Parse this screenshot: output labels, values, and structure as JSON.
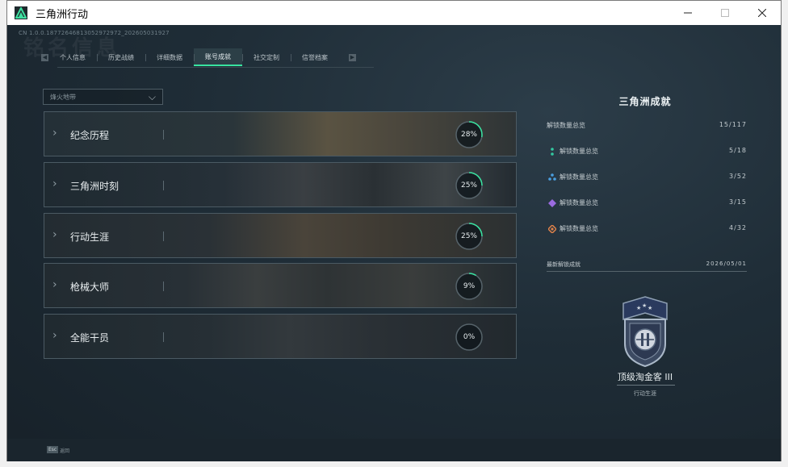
{
  "window": {
    "title": "三角洲行动"
  },
  "header": {
    "cn_id": "CN 1.0.0.18772646813052972972_202605031927",
    "bg_word": "铭名信息"
  },
  "tabs": [
    {
      "label": "个人信息"
    },
    {
      "label": "历史战绩"
    },
    {
      "label": "详细数据"
    },
    {
      "label": "账号成就"
    },
    {
      "label": "社交定制"
    },
    {
      "label": "信誉档案"
    }
  ],
  "dropdown": {
    "value": "烽火地带"
  },
  "categories": [
    {
      "name": "纪念历程",
      "percent": "28%",
      "progress": 0.28
    },
    {
      "name": "三角洲时刻",
      "percent": "25%",
      "progress": 0.25
    },
    {
      "name": "行动生涯",
      "percent": "25%",
      "progress": 0.25
    },
    {
      "name": "枪械大师",
      "percent": "9%",
      "progress": 0.09
    },
    {
      "name": "全能干员",
      "percent": "0%",
      "progress": 0.0
    }
  ],
  "summary": {
    "title": "三角洲成就",
    "total_label": "解锁数量总览",
    "total_value": "15/117",
    "rows": [
      {
        "label": "解锁数量总览",
        "value": "5/18",
        "icon": "green-tier-icon",
        "color": "#33c9a0"
      },
      {
        "label": "解锁数量总览",
        "value": "3/52",
        "icon": "blue-tier-icon",
        "color": "#4a9fe0"
      },
      {
        "label": "解锁数量总览",
        "value": "3/15",
        "icon": "purple-tier-icon",
        "color": "#9a6be0"
      },
      {
        "label": "解锁数量总览",
        "value": "4/32",
        "icon": "orange-tier-icon",
        "color": "#e0824a"
      }
    ]
  },
  "latest": {
    "label": "最新解锁成就",
    "date": "2026/05/01"
  },
  "badge": {
    "name": "顶级淘金客 III",
    "category": "行动生涯"
  },
  "footer": {
    "esc_key": "Esc",
    "esc_label": "返回"
  },
  "colors": {
    "accent": "#38e3a0"
  }
}
